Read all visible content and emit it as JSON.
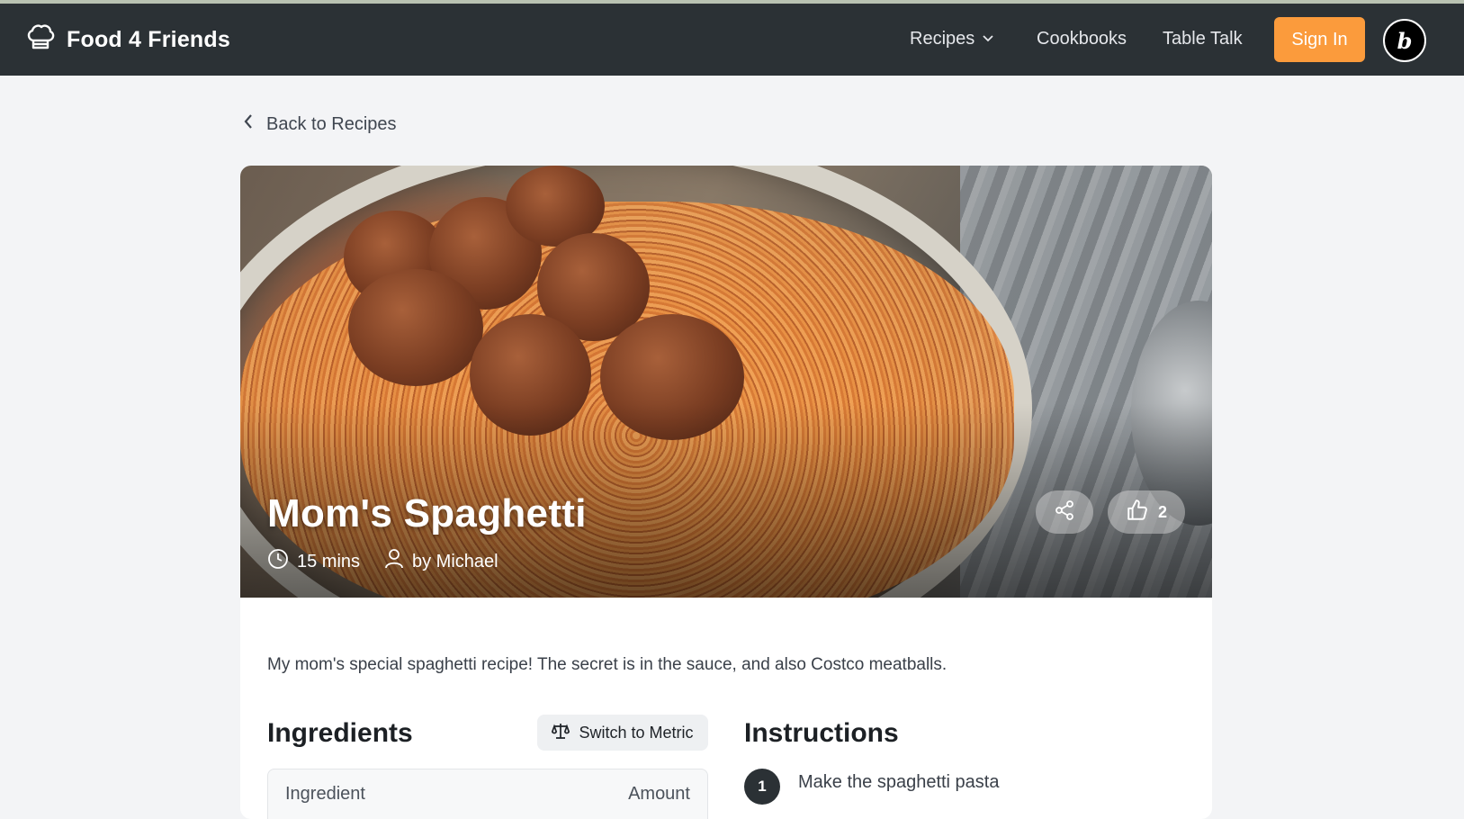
{
  "app": {
    "name": "Food 4 Friends",
    "logo_icon": "chef-hat-icon"
  },
  "nav": {
    "recipes": "Recipes",
    "cookbooks": "Cookbooks",
    "table_talk": "Table Talk",
    "sign_in": "Sign In",
    "badge_letter": "b"
  },
  "back_link": "Back to Recipes",
  "recipe": {
    "title": "Mom's Spaghetti",
    "time": "15 mins",
    "author": "by Michael",
    "likes": "2",
    "description": "My mom's special spaghetti recipe! The secret is in the sauce, and also Costco meatballs."
  },
  "ingredients": {
    "heading": "Ingredients",
    "switch_label": "Switch to Metric",
    "col_ingredient": "Ingredient",
    "col_amount": "Amount"
  },
  "instructions": {
    "heading": "Instructions",
    "steps": [
      {
        "number": "1",
        "text": "Make the spaghetti pasta"
      }
    ]
  },
  "colors": {
    "nav_bg": "#2b3135",
    "accent": "#fb9b3c",
    "page_bg": "#f3f4f6"
  }
}
